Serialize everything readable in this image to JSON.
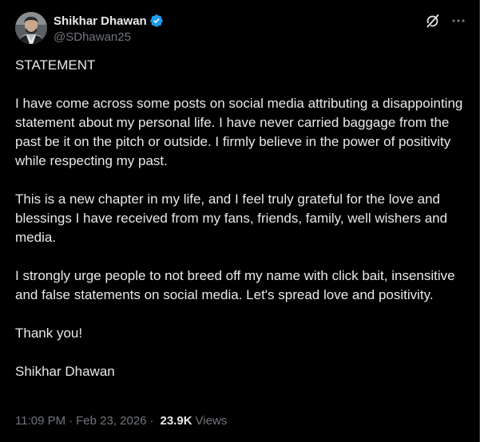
{
  "author": {
    "display_name": "Shikhar Dhawan",
    "handle": "@SDhawan25",
    "verified": true,
    "verified_color": "#1d9bf0",
    "avatar_icon": "profile-photo"
  },
  "actions": {
    "grok_icon": "grok-icon",
    "more_icon": "more-options-icon"
  },
  "post": {
    "paragraphs": [
      "STATEMENT",
      "I have come across some posts on social media attributing a disappointing statement about my personal life. I have never carried baggage from the past be it on the pitch or outside. I firmly believe in the power of positivity while respecting my past.",
      "This is a new chapter in my life, and I feel truly grateful for the love and blessings I have received from my fans, friends, family, well wishers and media.",
      "I strongly urge people to not breed off my name with click bait, insensitive and false statements on social media. Let's spread love and positivity.",
      "Thank you!",
      "Shikhar Dhawan"
    ]
  },
  "meta": {
    "time": "11:09 PM",
    "separator": "·",
    "date": "Feb 23, 2026",
    "separator2": "·",
    "views_count": "23.9K",
    "views_label": "Views"
  },
  "colors": {
    "background": "#000000",
    "text_primary": "#e7e9ea",
    "text_secondary": "#71767b"
  }
}
